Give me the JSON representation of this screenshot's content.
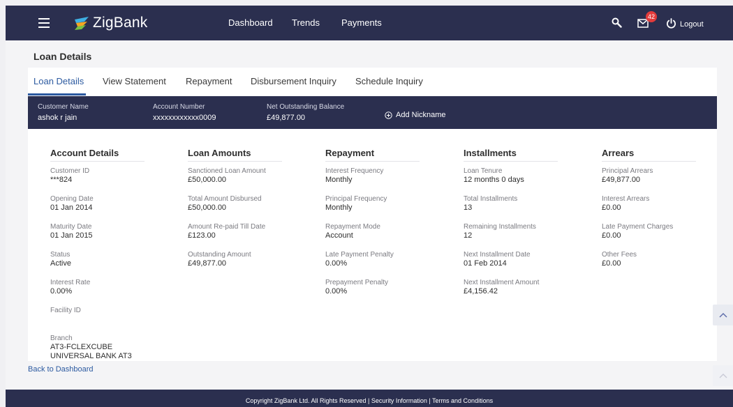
{
  "header": {
    "brand": "ZigBank",
    "nav": [
      "Dashboard",
      "Trends",
      "Payments"
    ],
    "notification_count": "42",
    "logout": "Logout"
  },
  "page_title": "Loan Details",
  "tabs": [
    "Loan Details",
    "View Statement",
    "Repayment",
    "Disbursement Inquiry",
    "Schedule Inquiry"
  ],
  "account": {
    "customer_name_label": "Customer Name",
    "customer_name": "ashok r jain",
    "account_number_label": "Account Number",
    "account_number": "xxxxxxxxxxxx0009",
    "balance_label": "Net Outstanding Balance",
    "balance": "£49,877.00",
    "add_nickname": "Add Nickname"
  },
  "sections": {
    "account_details": {
      "title": "Account Details",
      "fields": [
        {
          "label": "Customer ID",
          "value": "***824"
        },
        {
          "label": "Opening Date",
          "value": "01 Jan 2014"
        },
        {
          "label": "Maturity Date",
          "value": "01 Jan 2015"
        },
        {
          "label": "Status",
          "value": "Active"
        },
        {
          "label": "Interest Rate",
          "value": "0.00%"
        },
        {
          "label": "Facility ID",
          "value": ""
        },
        {
          "label": "Branch",
          "value": "AT3-FCLEXCUBE",
          "value2": "UNIVERSAL BANK AT3"
        }
      ]
    },
    "loan_amounts": {
      "title": "Loan Amounts",
      "fields": [
        {
          "label": "Sanctioned Loan Amount",
          "value": "£50,000.00"
        },
        {
          "label": "Total Amount Disbursed",
          "value": "£50,000.00"
        },
        {
          "label": "Amount Re-paid Till Date",
          "value": "£123.00"
        },
        {
          "label": "Outstanding Amount",
          "value": "£49,877.00"
        }
      ]
    },
    "repayment": {
      "title": "Repayment",
      "fields": [
        {
          "label": "Interest Frequency",
          "value": "Monthly"
        },
        {
          "label": "Principal Frequency",
          "value": "Monthly"
        },
        {
          "label": "Repayment Mode",
          "value": "Account"
        },
        {
          "label": "Late Payment Penalty",
          "value": "0.00%"
        },
        {
          "label": "Prepayment Penalty",
          "value": "0.00%"
        }
      ]
    },
    "installments": {
      "title": "Installments",
      "fields": [
        {
          "label": "Loan Tenure",
          "value": "12 months 0 days"
        },
        {
          "label": "Total Installments",
          "value": "13"
        },
        {
          "label": "Remaining Installments",
          "value": "12"
        },
        {
          "label": "Next Installment Date",
          "value": "01 Feb 2014"
        },
        {
          "label": "Next Installment Amount",
          "value": "£4,156.42"
        }
      ]
    },
    "arrears": {
      "title": "Arrears",
      "fields": [
        {
          "label": "Principal Arrears",
          "value": "£49,877.00"
        },
        {
          "label": "Interest Arrears",
          "value": "£0.00"
        },
        {
          "label": "Late Payment Charges",
          "value": "£0.00"
        },
        {
          "label": "Other Fees",
          "value": "£0.00"
        }
      ]
    }
  },
  "back_link": "Back to Dashboard",
  "footer": "Copyright ZigBank Ltd. All Rights Reserved | Security Information | Terms and Conditions",
  "colors": {
    "nav_bg": "#2b2f4f",
    "accent": "#2c5aa0",
    "badge": "#e23b3b"
  }
}
